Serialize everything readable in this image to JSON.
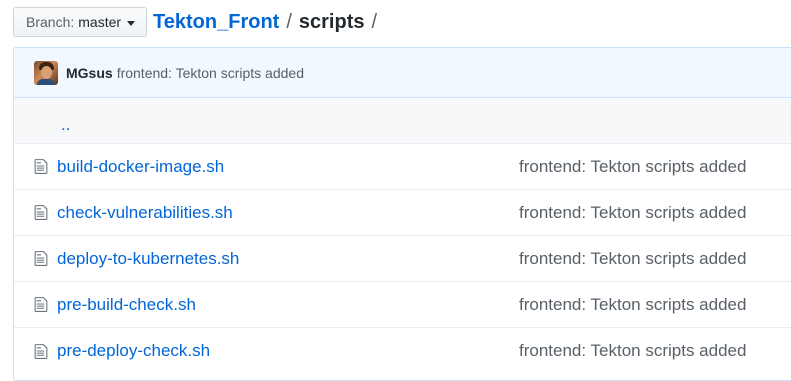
{
  "branch": {
    "prefix": "Branch:",
    "name": "master"
  },
  "breadcrumb": {
    "repo": "Tekton_Front",
    "separator": "/",
    "folder": "scripts",
    "trailing": "/"
  },
  "latest_commit": {
    "author": "MGsus",
    "message": "frontend: Tekton scripts added"
  },
  "up_link": "..",
  "files": [
    {
      "name": "build-docker-image.sh",
      "commit": "frontend: Tekton scripts added"
    },
    {
      "name": "check-vulnerabilities.sh",
      "commit": "frontend: Tekton scripts added"
    },
    {
      "name": "deploy-to-kubernetes.sh",
      "commit": "frontend: Tekton scripts added"
    },
    {
      "name": "pre-build-check.sh",
      "commit": "frontend: Tekton scripts added"
    },
    {
      "name": "pre-deploy-check.sh",
      "commit": "frontend: Tekton scripts added"
    }
  ],
  "icons": {
    "file": "file-icon",
    "caret": "caret-down-icon"
  },
  "colors": {
    "link": "#0366d6",
    "commit_bar_bg": "#f1f8ff",
    "border": "#c8e1ff",
    "muted": "#586069"
  }
}
